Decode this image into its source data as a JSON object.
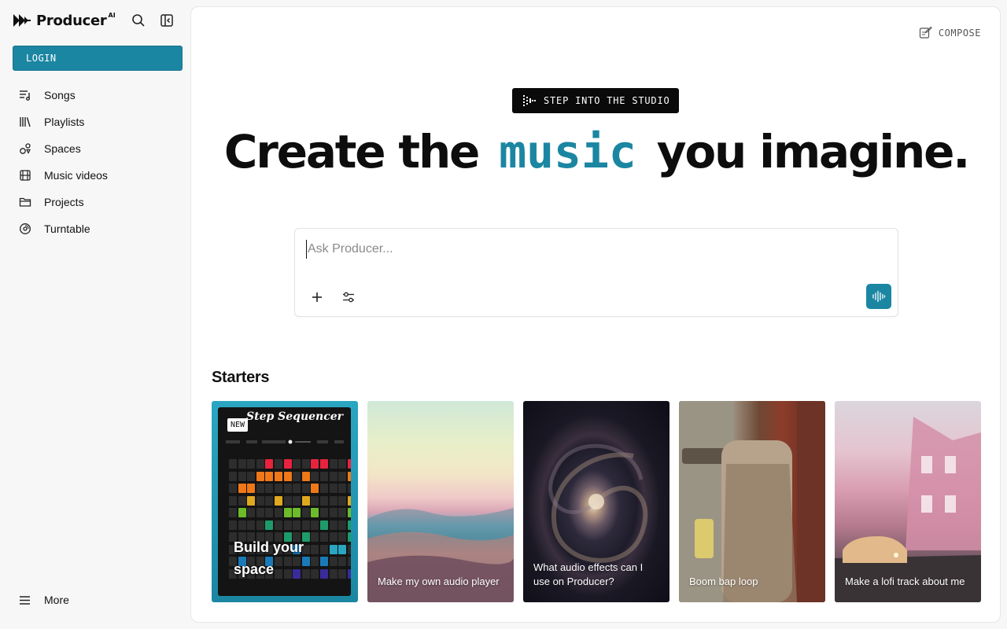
{
  "app": {
    "name": "Producer",
    "name_sup": "AI"
  },
  "sidebar": {
    "login_label": "LOGIN",
    "items": [
      {
        "label": "Songs",
        "icon": "songs-icon"
      },
      {
        "label": "Playlists",
        "icon": "playlists-icon"
      },
      {
        "label": "Spaces",
        "icon": "spaces-icon"
      },
      {
        "label": "Music videos",
        "icon": "film-icon"
      },
      {
        "label": "Projects",
        "icon": "folder-icon"
      },
      {
        "label": "Turntable",
        "icon": "vinyl-icon"
      }
    ],
    "more_label": "More"
  },
  "main": {
    "compose_label": "COMPOSE",
    "studio_badge": "STEP INTO THE STUDIO",
    "hero": {
      "before": "Create the",
      "accent": "music",
      "after": "you imagine."
    },
    "prompt": {
      "placeholder": "Ask Producer..."
    },
    "starters_title": "Starters",
    "starters": [
      {
        "label": "Build your space",
        "badge": "NEW",
        "card_title": "Step Sequencer"
      },
      {
        "label": "Make my own audio player"
      },
      {
        "label": "What audio effects can I use on Producer?"
      },
      {
        "label": "Boom bap loop"
      },
      {
        "label": "Make a lofi track about me"
      }
    ]
  },
  "colors": {
    "accent": "#1b86a2",
    "badge_bg": "#0a0a0a",
    "sidebar_bg": "#f7f7f7"
  }
}
